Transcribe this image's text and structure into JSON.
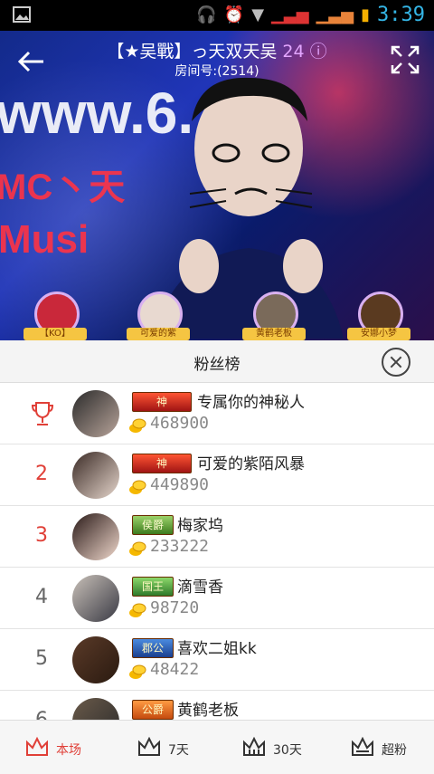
{
  "status": {
    "time": "3:39"
  },
  "header": {
    "title": "【★吴戰】っ天双天吴",
    "viewer_count": "24",
    "room_number": "房间号:(2514)"
  },
  "stream_overlay": {
    "texts": [
      "www.6.",
      "MC丶天",
      "Musi"
    ]
  },
  "top_fans": [
    {
      "label": "【KO】"
    },
    {
      "label": "可爱的紫"
    },
    {
      "label": "黄鹤老板"
    },
    {
      "label": "安娜小梦"
    }
  ],
  "panel": {
    "title": "粉丝榜"
  },
  "leaderboard": [
    {
      "rank": "",
      "badge": "神",
      "name": "专属你的神秘人",
      "score": "468900"
    },
    {
      "rank": "2",
      "badge": "神",
      "name": "可爱的紫陌风暴",
      "score": "449890"
    },
    {
      "rank": "3",
      "badge": "侯爵",
      "name": "梅家坞",
      "score": "233222"
    },
    {
      "rank": "4",
      "badge": "国王",
      "name": "滴雪香",
      "score": "98720"
    },
    {
      "rank": "5",
      "badge": "郡公",
      "name": "喜欢二姐kk",
      "score": "48422"
    },
    {
      "rank": "6",
      "badge": "公爵",
      "name": "黄鹤老板",
      "score": ""
    }
  ],
  "tabs": [
    {
      "label": "本场",
      "active": true
    },
    {
      "label": "7天",
      "active": false
    },
    {
      "label": "30天",
      "active": false
    },
    {
      "label": "超粉",
      "active": false
    }
  ]
}
